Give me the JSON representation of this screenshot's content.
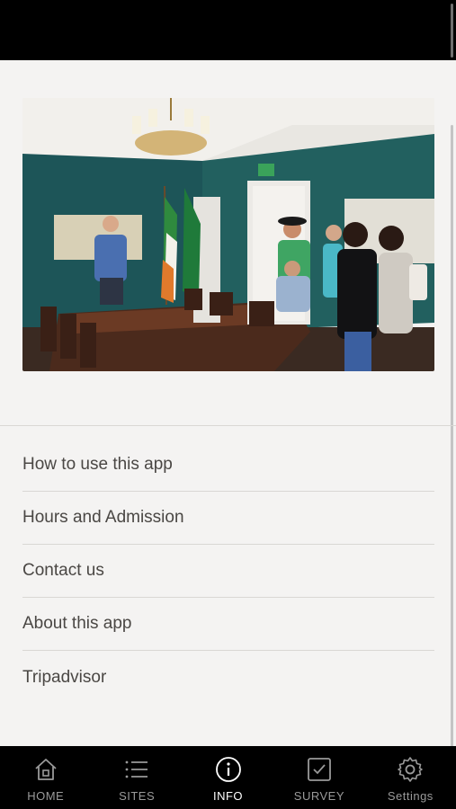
{
  "menu": {
    "items": [
      {
        "label": "How to use this app"
      },
      {
        "label": "Hours and Admission"
      },
      {
        "label": "Contact us"
      },
      {
        "label": "About this app"
      },
      {
        "label": "Tripadvisor"
      }
    ]
  },
  "tabbar": {
    "active": "info",
    "tabs": [
      {
        "label": "HOME",
        "icon": "home-icon"
      },
      {
        "label": "SITES",
        "icon": "list-icon"
      },
      {
        "label": "INFO",
        "icon": "info-icon"
      },
      {
        "label": "SURVEY",
        "icon": "checkbox-icon"
      },
      {
        "label": "Settings",
        "icon": "gear-icon"
      }
    ]
  },
  "colors": {
    "background": "#f4f3f2",
    "text": "#4a4744",
    "bar": "#000000",
    "tab_inactive": "#9a9a9a",
    "tab_active": "#ffffff",
    "wall": "#1f5a5e"
  }
}
